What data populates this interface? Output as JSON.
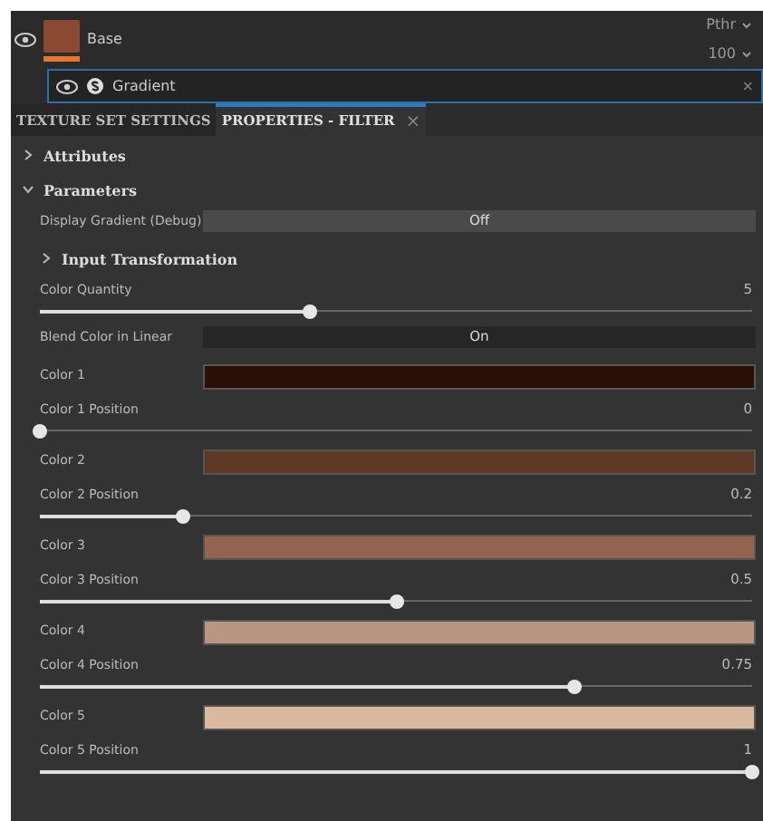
{
  "layers": [
    {
      "name": "Base",
      "blend": "Pthr",
      "opacity": "100",
      "selected": false
    },
    {
      "name": "Gradient",
      "selected": true,
      "close": "×"
    }
  ],
  "tabs": [
    {
      "label": "TEXTURE SET SETTINGS",
      "selected": false
    },
    {
      "label": "PROPERTIES - FILTER",
      "selected": true,
      "close": "×"
    }
  ],
  "sections": [
    {
      "label": "Attributes",
      "expanded": false
    },
    {
      "label": "Parameters",
      "expanded": true,
      "rows": [
        {
          "kind": "toggle",
          "label": "Display Gradient (Debug)",
          "value": "Off",
          "on": false
        },
        {
          "kind": "section",
          "label": "Input Transformation",
          "expanded": false
        },
        {
          "kind": "slider",
          "label": "Color Quantity",
          "value": "5",
          "level": 0.38
        },
        {
          "kind": "toggle",
          "label": "Blend Color in Linear",
          "value": "On",
          "on": true
        },
        {
          "kind": "color",
          "label": "Color 1",
          "color": "#2a1009"
        },
        {
          "kind": "slider",
          "label": "Color 1 Position",
          "value": "0",
          "level": 0
        },
        {
          "kind": "color",
          "label": "Color 2",
          "color": "#5e3a24"
        },
        {
          "kind": "slider",
          "label": "Color 2 Position",
          "value": "0.2",
          "level": 0.2
        },
        {
          "kind": "color",
          "label": "Color 3",
          "color": "#946450"
        },
        {
          "kind": "slider",
          "label": "Color 3 Position",
          "value": "0.5",
          "level": 0.5
        },
        {
          "kind": "color",
          "label": "Color 4",
          "color": "#ba9580"
        },
        {
          "kind": "slider",
          "label": "Color 4 Position",
          "value": "0.75",
          "level": 0.75
        },
        {
          "kind": "color",
          "label": "Color 5",
          "color": "#d9b9a0"
        },
        {
          "kind": "slider",
          "label": "Color 5 Position",
          "value": "1",
          "level": 1
        }
      ]
    }
  ]
}
